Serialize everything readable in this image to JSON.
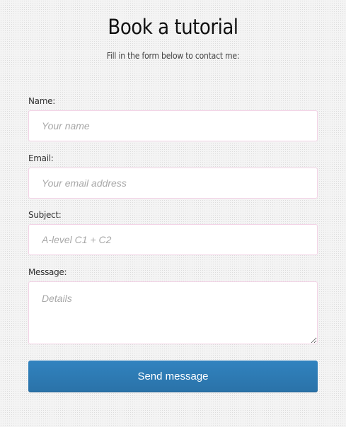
{
  "page": {
    "title": "Book a tutorial",
    "subtitle": "Fill in the form below to contact me:"
  },
  "form": {
    "name": {
      "label": "Name:",
      "placeholder": "Your name"
    },
    "email": {
      "label": "Email:",
      "placeholder": "Your email address"
    },
    "subject": {
      "label": "Subject:",
      "placeholder": "A-level C1 + C2"
    },
    "message": {
      "label": "Message:",
      "placeholder": "Details"
    },
    "submit_label": "Send message"
  },
  "colors": {
    "button": "#2e7bb5",
    "field_border": "#f3d3e6"
  }
}
